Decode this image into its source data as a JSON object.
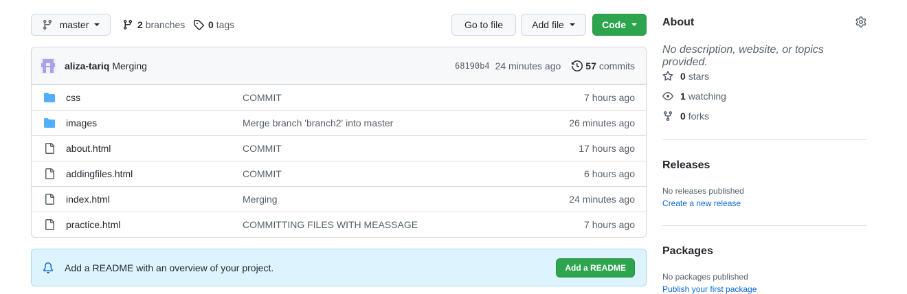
{
  "toolbar": {
    "branch_label": "master",
    "branches_count": "2",
    "branches_label": "branches",
    "tags_count": "0",
    "tags_label": "tags",
    "go_to_file": "Go to file",
    "add_file": "Add file",
    "code": "Code"
  },
  "latest_commit": {
    "author": "aliza-tariq",
    "message": "Merging",
    "sha": "68190b4",
    "time": "24 minutes ago",
    "commits_count": "57",
    "commits_label": "commits"
  },
  "files": [
    {
      "type": "dir",
      "name": "css",
      "message": "COMMIT",
      "age": "7 hours ago"
    },
    {
      "type": "dir",
      "name": "images",
      "message": "Merge branch 'branch2' into master",
      "age": "26 minutes ago"
    },
    {
      "type": "file",
      "name": "about.html",
      "message": "COMMIT",
      "age": "17 hours ago"
    },
    {
      "type": "file",
      "name": "addingfiles.html",
      "message": "COMMIT",
      "age": "6 hours ago"
    },
    {
      "type": "file",
      "name": "index.html",
      "message": "Merging",
      "age": "24 minutes ago"
    },
    {
      "type": "file",
      "name": "practice.html",
      "message": "COMMITTING FILES WITH MEASSAGE",
      "age": "7 hours ago"
    }
  ],
  "readme_banner": {
    "text": "Add a README with an overview of your project.",
    "button": "Add a README"
  },
  "about": {
    "title": "About",
    "description": "No description, website, or topics provided.",
    "stars_count": "0",
    "stars_label": "stars",
    "watching_count": "1",
    "watching_label": "watching",
    "forks_count": "0",
    "forks_label": "forks"
  },
  "releases": {
    "title": "Releases",
    "empty": "No releases published",
    "link": "Create a new release"
  },
  "packages": {
    "title": "Packages",
    "empty": "No packages published",
    "link": "Publish your first package"
  },
  "colors": {
    "folder_icon": "#54aeff",
    "green_button": "#2da44e",
    "link": "#0969da",
    "readme_bg": "#ddf4ff"
  }
}
